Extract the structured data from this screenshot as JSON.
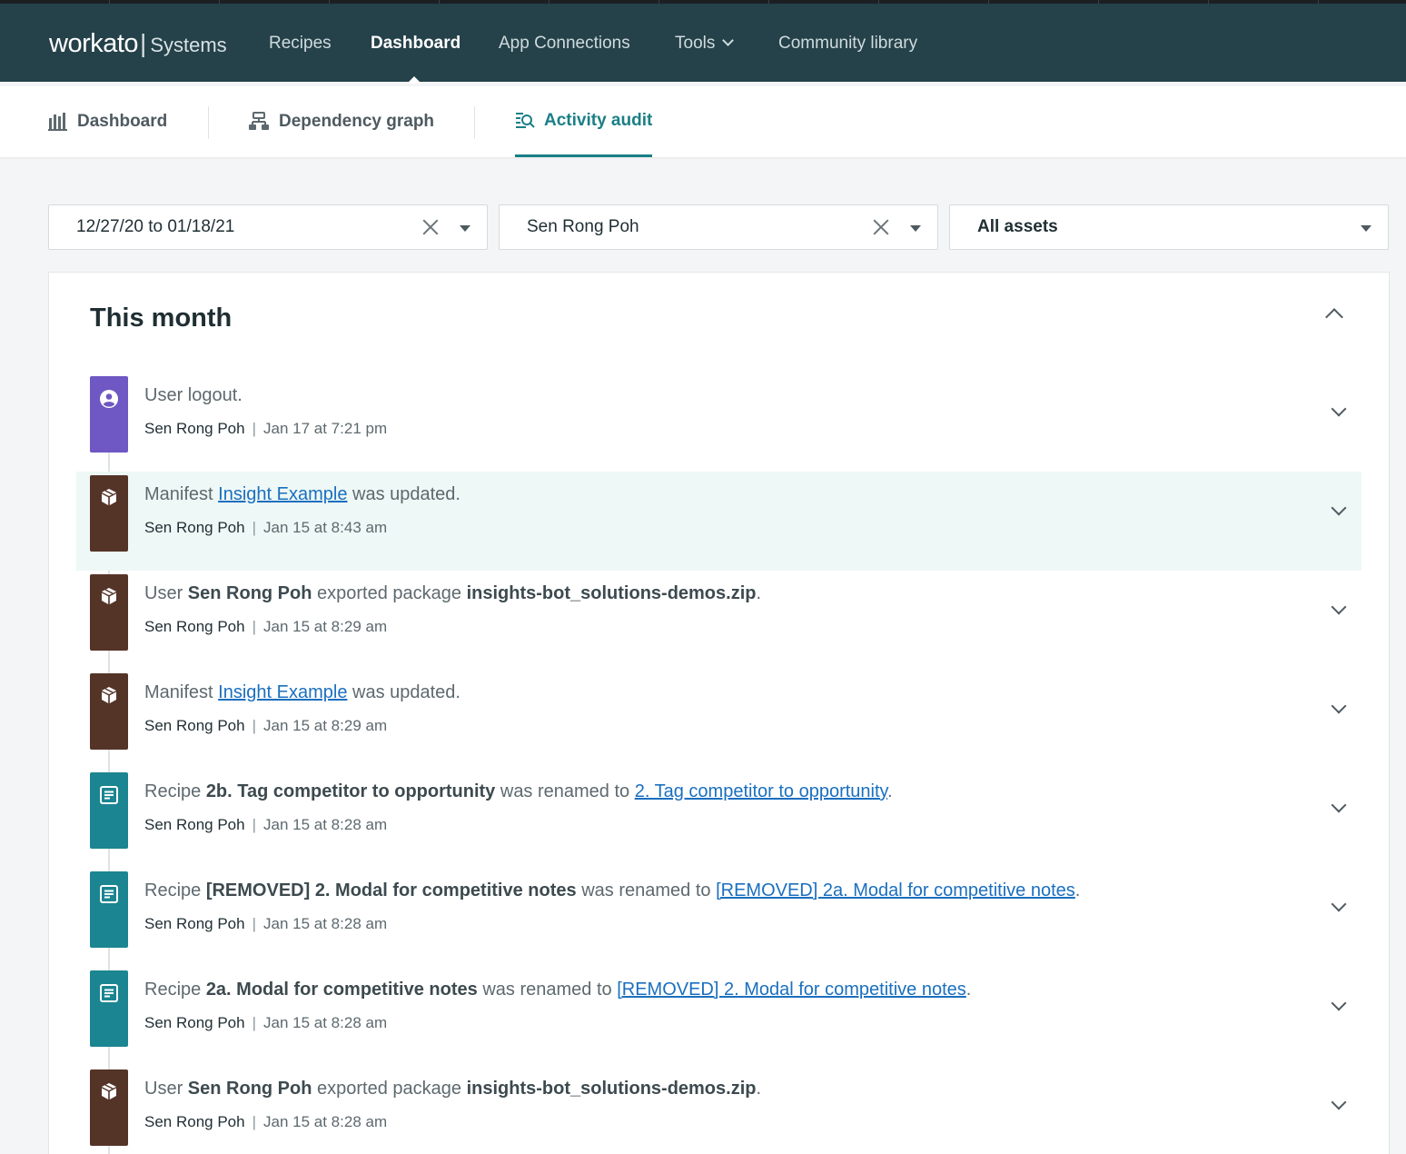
{
  "brand": {
    "name": "workato",
    "separator": "|",
    "workspace": "Systems"
  },
  "nav": {
    "items": [
      "Recipes",
      "Dashboard",
      "App Connections",
      "Tools",
      "Community library"
    ],
    "active": "Dashboard"
  },
  "subtabs": [
    "Dashboard",
    "Dependency graph",
    "Activity audit"
  ],
  "filters": {
    "date_range": "12/27/20 to 01/18/21",
    "user": "Sen Rong Poh",
    "assets": "All assets"
  },
  "section": {
    "title": "This month"
  },
  "entries": [
    {
      "icon": "user-icon",
      "color": "#6f57c4",
      "parts": [
        [
          "t",
          "User logout."
        ]
      ],
      "user": "Sen Rong Poh",
      "time": "Jan 17 at 7:21 pm"
    },
    {
      "icon": "package-icon",
      "color": "#553428",
      "parts": [
        [
          "t",
          "Manifest "
        ],
        [
          "a",
          "Insight Example"
        ],
        [
          "t",
          " was updated."
        ]
      ],
      "user": "Sen Rong Poh",
      "time": "Jan 15 at 8:43 am"
    },
    {
      "icon": "package-icon",
      "color": "#553428",
      "parts": [
        [
          "t",
          "User "
        ],
        [
          "b",
          "Sen Rong Poh"
        ],
        [
          "t",
          " exported package "
        ],
        [
          "b",
          "insights-bot_solutions-demos.zip"
        ],
        [
          "t",
          "."
        ]
      ],
      "user": "Sen Rong Poh",
      "time": "Jan 15 at 8:29 am"
    },
    {
      "icon": "package-icon",
      "color": "#553428",
      "parts": [
        [
          "t",
          "Manifest "
        ],
        [
          "a",
          "Insight Example"
        ],
        [
          "t",
          " was updated."
        ]
      ],
      "user": "Sen Rong Poh",
      "time": "Jan 15 at 8:29 am"
    },
    {
      "icon": "recipe-icon",
      "color": "#1b8591",
      "parts": [
        [
          "t",
          "Recipe "
        ],
        [
          "b",
          "2b. Tag competitor to opportunity"
        ],
        [
          "t",
          " was renamed to "
        ],
        [
          "a",
          "2. Tag competitor to opportunity"
        ],
        [
          "t",
          "."
        ]
      ],
      "user": "Sen Rong Poh",
      "time": "Jan 15 at 8:28 am"
    },
    {
      "icon": "recipe-icon",
      "color": "#1b8591",
      "parts": [
        [
          "t",
          "Recipe "
        ],
        [
          "b",
          "[REMOVED] 2. Modal for competitive notes"
        ],
        [
          "t",
          " was renamed to "
        ],
        [
          "a",
          "[REMOVED] 2a. Modal for competitive notes"
        ],
        [
          "t",
          "."
        ]
      ],
      "user": "Sen Rong Poh",
      "time": "Jan 15 at 8:28 am"
    },
    {
      "icon": "recipe-icon",
      "color": "#1b8591",
      "parts": [
        [
          "t",
          "Recipe "
        ],
        [
          "b",
          "2a. Modal for competitive notes"
        ],
        [
          "t",
          " was renamed to "
        ],
        [
          "a",
          "[REMOVED] 2. Modal for competitive notes"
        ],
        [
          "t",
          "."
        ]
      ],
      "user": "Sen Rong Poh",
      "time": "Jan 15 at 8:28 am"
    },
    {
      "icon": "package-icon",
      "color": "#553428",
      "parts": [
        [
          "t",
          "User "
        ],
        [
          "b",
          "Sen Rong Poh"
        ],
        [
          "t",
          " exported package "
        ],
        [
          "b",
          "insights-bot_solutions-demos.zip"
        ],
        [
          "t",
          "."
        ]
      ],
      "user": "Sen Rong Poh",
      "time": "Jan 15 at 8:28 am"
    }
  ],
  "meta_separator": "|"
}
